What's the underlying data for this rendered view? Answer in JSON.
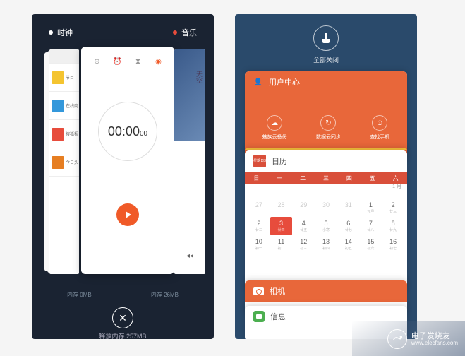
{
  "left": {
    "tabs": {
      "clock": "时钟",
      "music": "音乐"
    },
    "browser_items": [
      "节目",
      "在线商",
      "搜狐视",
      "今日头"
    ],
    "timer": {
      "time": "00:00",
      "sub": "00"
    },
    "music_art_text": "天空",
    "memory": {
      "left": "内存 0MB",
      "right": "内存 26MB"
    },
    "close_icon": "✕",
    "release": "释放内存 257MB"
  },
  "right": {
    "clean": "全部关闭",
    "user": {
      "title": "用户中心",
      "items": [
        {
          "icon": "☁",
          "label": "魅族云备份"
        },
        {
          "icon": "↻",
          "label": "数据云同步"
        },
        {
          "icon": "⊙",
          "label": "查找手机"
        }
      ]
    },
    "calendar": {
      "title": "日历",
      "icon_label": "星期日3",
      "month_label": "1\n月",
      "week": [
        "日",
        "一",
        "二",
        "三",
        "四",
        "五",
        "六"
      ],
      "days": [
        {
          "n": "27",
          "l": "",
          "dim": true
        },
        {
          "n": "28",
          "l": "",
          "dim": true
        },
        {
          "n": "29",
          "l": "",
          "dim": true
        },
        {
          "n": "30",
          "l": "",
          "dim": true
        },
        {
          "n": "31",
          "l": "",
          "dim": true
        },
        {
          "n": "1",
          "l": "元旦"
        },
        {
          "n": "2",
          "l": "廿三"
        },
        {
          "n": "2",
          "l": "廿三"
        },
        {
          "n": "3",
          "l": "廿四",
          "sel": true
        },
        {
          "n": "4",
          "l": "廿五"
        },
        {
          "n": "5",
          "l": "小寒"
        },
        {
          "n": "6",
          "l": "廿七"
        },
        {
          "n": "7",
          "l": "廿八"
        },
        {
          "n": "8",
          "l": "廿九"
        },
        {
          "n": "10",
          "l": "初一"
        },
        {
          "n": "11",
          "l": "初二"
        },
        {
          "n": "12",
          "l": "初三"
        },
        {
          "n": "13",
          "l": "初四"
        },
        {
          "n": "14",
          "l": "初五"
        },
        {
          "n": "15",
          "l": "初六"
        },
        {
          "n": "16",
          "l": "初七"
        }
      ]
    },
    "camera": {
      "title": "相机"
    },
    "messages": {
      "title": "信息"
    }
  },
  "watermark": {
    "brand": "电子发烧友",
    "url": "www.elecfans.com"
  }
}
